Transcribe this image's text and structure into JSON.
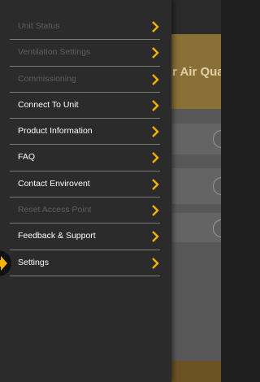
{
  "background": {
    "title_fragment": "r Air Qua"
  },
  "menu": {
    "items": [
      {
        "label": "Unit Status",
        "enabled": false
      },
      {
        "label": "Ventilation Settings",
        "enabled": false
      },
      {
        "label": "Commissioning",
        "enabled": false
      },
      {
        "label": "Connect To Unit",
        "enabled": true
      },
      {
        "label": "Product Information",
        "enabled": true
      },
      {
        "label": "FAQ",
        "enabled": true
      },
      {
        "label": "Contact Envirovent",
        "enabled": true
      },
      {
        "label": "Reset Access Point",
        "enabled": false
      },
      {
        "label": "Feedback & Support",
        "enabled": true
      },
      {
        "label": "Settings",
        "enabled": true,
        "highlighted": true
      }
    ],
    "chevron_icon": "chevron-right-icon",
    "highlight_icon": "arrow-right-icon"
  },
  "colors": {
    "accent": "#f5b400",
    "drawer_bg": "#2b2b2b",
    "enabled_text": "#ffffff",
    "disabled_text": "#5f5f5f",
    "divider": "#7a7a7a"
  }
}
